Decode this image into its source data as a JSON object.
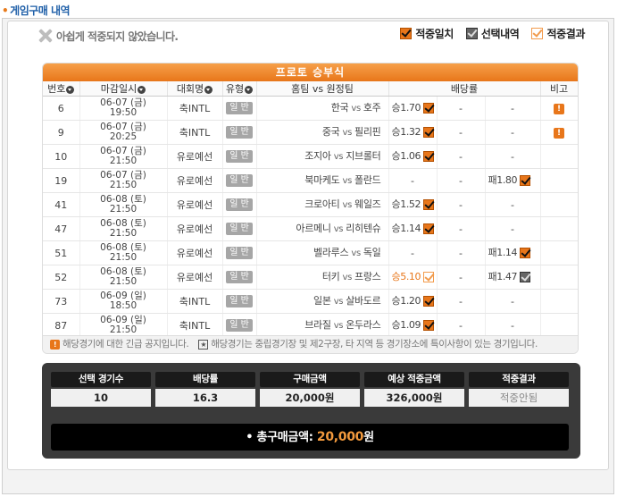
{
  "page_title": "게임구매 내역",
  "status_message": "아쉽게 적중되지 않았습니다.",
  "legend": {
    "hit": "적중일치",
    "selected": "선택내역",
    "result": "적중결과"
  },
  "table": {
    "title": "프로토 승부식",
    "headers": {
      "no": "번호",
      "deadline": "마감일시",
      "league": "대회명",
      "type": "유형",
      "match": "홈팀 vs 원정팀",
      "odds": "배당률",
      "note": "비고"
    },
    "rows": [
      {
        "no": "6",
        "date": "06-07 (금)",
        "time": "19:50",
        "league": "축INTL",
        "type": "일 반",
        "home": "한국",
        "away": "호주",
        "win": "승1.70",
        "draw": "-",
        "lose": "-",
        "pick": "win",
        "note": "!"
      },
      {
        "no": "9",
        "date": "06-07 (금)",
        "time": "20:25",
        "league": "축INTL",
        "type": "일 반",
        "home": "중국",
        "away": "필리핀",
        "win": "승1.32",
        "draw": "-",
        "lose": "-",
        "pick": "win",
        "note": "!"
      },
      {
        "no": "10",
        "date": "06-07 (금)",
        "time": "21:50",
        "league": "유로예선",
        "type": "일 반",
        "home": "조지아",
        "away": "지브롤터",
        "win": "승1.06",
        "draw": "-",
        "lose": "-",
        "pick": "win",
        "note": ""
      },
      {
        "no": "19",
        "date": "06-07 (금)",
        "time": "21:50",
        "league": "유로예선",
        "type": "일 반",
        "home": "북마케도",
        "away": "폴란드",
        "win": "-",
        "draw": "-",
        "lose": "패1.80",
        "pick": "lose",
        "note": ""
      },
      {
        "no": "41",
        "date": "06-08 (토)",
        "time": "21:50",
        "league": "유로예선",
        "type": "일 반",
        "home": "크로아티",
        "away": "웨일즈",
        "win": "승1.52",
        "draw": "-",
        "lose": "-",
        "pick": "win",
        "note": ""
      },
      {
        "no": "47",
        "date": "06-08 (토)",
        "time": "21:50",
        "league": "유로예선",
        "type": "일 반",
        "home": "아르메니",
        "away": "리히텐슈",
        "win": "승1.14",
        "draw": "-",
        "lose": "-",
        "pick": "win",
        "note": ""
      },
      {
        "no": "51",
        "date": "06-08 (토)",
        "time": "21:50",
        "league": "유로예선",
        "type": "일 반",
        "home": "벨라루스",
        "away": "독일",
        "win": "-",
        "draw": "-",
        "lose": "패1.14",
        "pick": "lose",
        "note": ""
      },
      {
        "no": "52",
        "date": "06-08 (토)",
        "time": "21:50",
        "league": "유로예선",
        "type": "일 반",
        "home": "터키",
        "away": "프랑스",
        "win": "승5.10",
        "draw": "-",
        "lose": "패1.47",
        "pick": "mixed",
        "note": ""
      },
      {
        "no": "73",
        "date": "06-09 (일)",
        "time": "18:50",
        "league": "축INTL",
        "type": "일 반",
        "home": "일본",
        "away": "살바도르",
        "win": "승1.20",
        "draw": "-",
        "lose": "-",
        "pick": "win",
        "note": ""
      },
      {
        "no": "87",
        "date": "06-09 (일)",
        "time": "21:50",
        "league": "축INTL",
        "type": "일 반",
        "home": "브라질",
        "away": "온두라스",
        "win": "승1.09",
        "draw": "-",
        "lose": "-",
        "pick": "win",
        "note": ""
      }
    ],
    "vs": "vs",
    "notice_1": "해당경기에 대한 긴급 공지입니다.",
    "notice_2": "해당경기는 중립경기장 및 제2구장, 타 지역 등 경기장소에 특이사항이 있는 경기입니다."
  },
  "summary": {
    "headers": [
      "선택 경기수",
      "배당률",
      "구매금액",
      "예상 적중금액",
      "적중결과"
    ],
    "values": [
      "10",
      "16.3",
      "20,000원",
      "326,000원",
      "적중안됨"
    ],
    "total_label": "총구매금액:",
    "total_amount": "20,000",
    "total_unit": "원"
  },
  "colors": {
    "accent": "#e8761a",
    "title_blue": "#1f5fa8"
  }
}
